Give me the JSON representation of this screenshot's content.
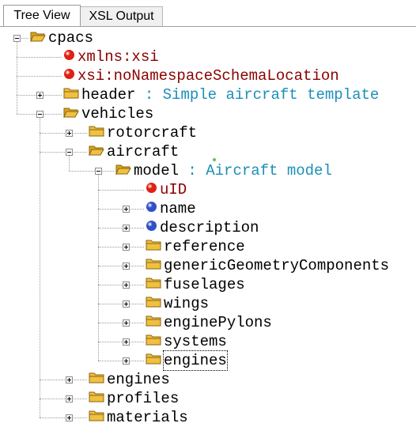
{
  "tabs": {
    "tree_view": "Tree View",
    "xsl_output": "XSL Output",
    "active": "tree_view"
  },
  "tree": {
    "nodes": [
      {
        "name": "tree-node-cpacs",
        "label": "cpacs",
        "icon": "folder-open-icon",
        "kind": "element",
        "expander": "minus",
        "separator": "",
        "description": ""
      },
      {
        "name": "tree-node-xmlns-xsi",
        "label": "xmlns:xsi",
        "icon": "attribute-dot-icon",
        "kind": "attribute",
        "expander": "",
        "separator": "",
        "description": ""
      },
      {
        "name": "tree-node-xsi-nonamespaceschemalocation",
        "label": "xsi:noNamespaceSchemaLocation",
        "icon": "attribute-dot-icon",
        "kind": "attribute",
        "expander": "",
        "separator": "",
        "description": ""
      },
      {
        "name": "tree-node-header",
        "label": "header",
        "icon": "folder-icon",
        "kind": "element",
        "expander": "plus",
        "separator": " : ",
        "description": "Simple aircraft template"
      },
      {
        "name": "tree-node-vehicles",
        "label": "vehicles",
        "icon": "folder-open-icon",
        "kind": "element",
        "expander": "minus",
        "separator": "",
        "description": ""
      },
      {
        "name": "tree-node-rotorcraft",
        "label": "rotorcraft",
        "icon": "folder-icon",
        "kind": "element",
        "expander": "plus",
        "separator": "",
        "description": ""
      },
      {
        "name": "tree-node-aircraft",
        "label": "aircraft",
        "icon": "folder-open-icon",
        "kind": "element",
        "expander": "minus",
        "separator": "",
        "description": ""
      },
      {
        "name": "tree-node-model",
        "label": "model",
        "icon": "folder-open-icon",
        "kind": "element",
        "expander": "minus",
        "separator": " : ",
        "description": "Aircraft model"
      },
      {
        "name": "tree-node-uid",
        "label": "uID",
        "icon": "attribute-dot-icon",
        "kind": "attribute",
        "expander": "",
        "separator": "",
        "description": ""
      },
      {
        "name": "tree-node-name",
        "label": "name",
        "icon": "text-node-dot-icon",
        "kind": "element",
        "expander": "plus",
        "separator": "",
        "description": ""
      },
      {
        "name": "tree-node-description",
        "label": "description",
        "icon": "text-node-dot-icon",
        "kind": "element",
        "expander": "plus",
        "separator": "",
        "description": ""
      },
      {
        "name": "tree-node-reference",
        "label": "reference",
        "icon": "folder-icon",
        "kind": "element",
        "expander": "plus",
        "separator": "",
        "description": ""
      },
      {
        "name": "tree-node-genericgeometrycomponents",
        "label": "genericGeometryComponents",
        "icon": "folder-icon",
        "kind": "element",
        "expander": "plus",
        "separator": "",
        "description": ""
      },
      {
        "name": "tree-node-fuselages",
        "label": "fuselages",
        "icon": "folder-icon",
        "kind": "element",
        "expander": "plus",
        "separator": "",
        "description": ""
      },
      {
        "name": "tree-node-wings",
        "label": "wings",
        "icon": "folder-icon",
        "kind": "element",
        "expander": "plus",
        "separator": "",
        "description": ""
      },
      {
        "name": "tree-node-enginepylons",
        "label": "enginePylons",
        "icon": "folder-icon",
        "kind": "element",
        "expander": "plus",
        "separator": "",
        "description": ""
      },
      {
        "name": "tree-node-systems",
        "label": "systems",
        "icon": "folder-icon",
        "kind": "element",
        "expander": "plus",
        "separator": "",
        "description": ""
      },
      {
        "name": "tree-node-engines-model",
        "label": "engines",
        "icon": "folder-icon",
        "kind": "element",
        "expander": "plus",
        "separator": "",
        "description": "",
        "selected": true
      },
      {
        "name": "tree-node-engines",
        "label": "engines",
        "icon": "folder-icon",
        "kind": "element",
        "expander": "plus",
        "separator": "",
        "description": ""
      },
      {
        "name": "tree-node-profiles",
        "label": "profiles",
        "icon": "folder-icon",
        "kind": "element",
        "expander": "plus",
        "separator": "",
        "description": ""
      },
      {
        "name": "tree-node-materials",
        "label": "materials",
        "icon": "folder-icon",
        "kind": "element",
        "expander": "plus",
        "separator": "",
        "description": ""
      }
    ]
  },
  "colors": {
    "attribute_text": "#8b0000",
    "description_text": "#1b8fb8",
    "attribute_dot": "#e02010",
    "text_node_dot": "#3050c8",
    "folder": "#f0c040"
  }
}
